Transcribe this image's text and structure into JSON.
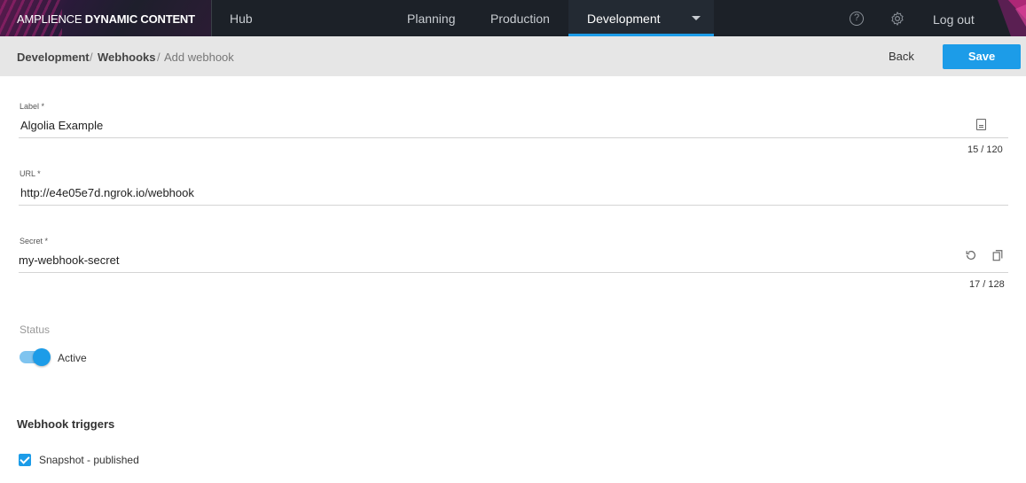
{
  "brand": {
    "light": "AMPLIENCE ",
    "bold": "DYNAMIC CONTENT"
  },
  "nav": {
    "hub": "Hub",
    "planning": "Planning",
    "production": "Production",
    "development": "Development",
    "help_icon": "question-circle-icon",
    "settings_icon": "gear-icon",
    "logout": "Log out"
  },
  "breadcrumb": {
    "items": [
      "Development",
      "Webhooks",
      "Add webhook"
    ],
    "separator": "/"
  },
  "actions": {
    "back": "Back",
    "save": "Save"
  },
  "form": {
    "label": {
      "title": "Label *",
      "value": "Algolia Example",
      "counter": "15 / 120",
      "icon": "document-icon"
    },
    "url": {
      "title": "URL *",
      "value": "http://e4e05e7d.ngrok.io/webhook"
    },
    "secret": {
      "title": "Secret *",
      "value": "my-webhook-secret",
      "counter": "17 / 128",
      "icons": [
        "refresh-icon",
        "copy-icon"
      ]
    },
    "status": {
      "title": "Status",
      "value": "Active",
      "enabled": true
    }
  },
  "triggers": {
    "title": "Webhook triggers",
    "items": [
      {
        "label": "Snapshot - published",
        "checked": true
      }
    ]
  },
  "colors": {
    "accent": "#1c9ce8",
    "topbar": "#1c2128",
    "subbar": "#e6e6e6"
  }
}
